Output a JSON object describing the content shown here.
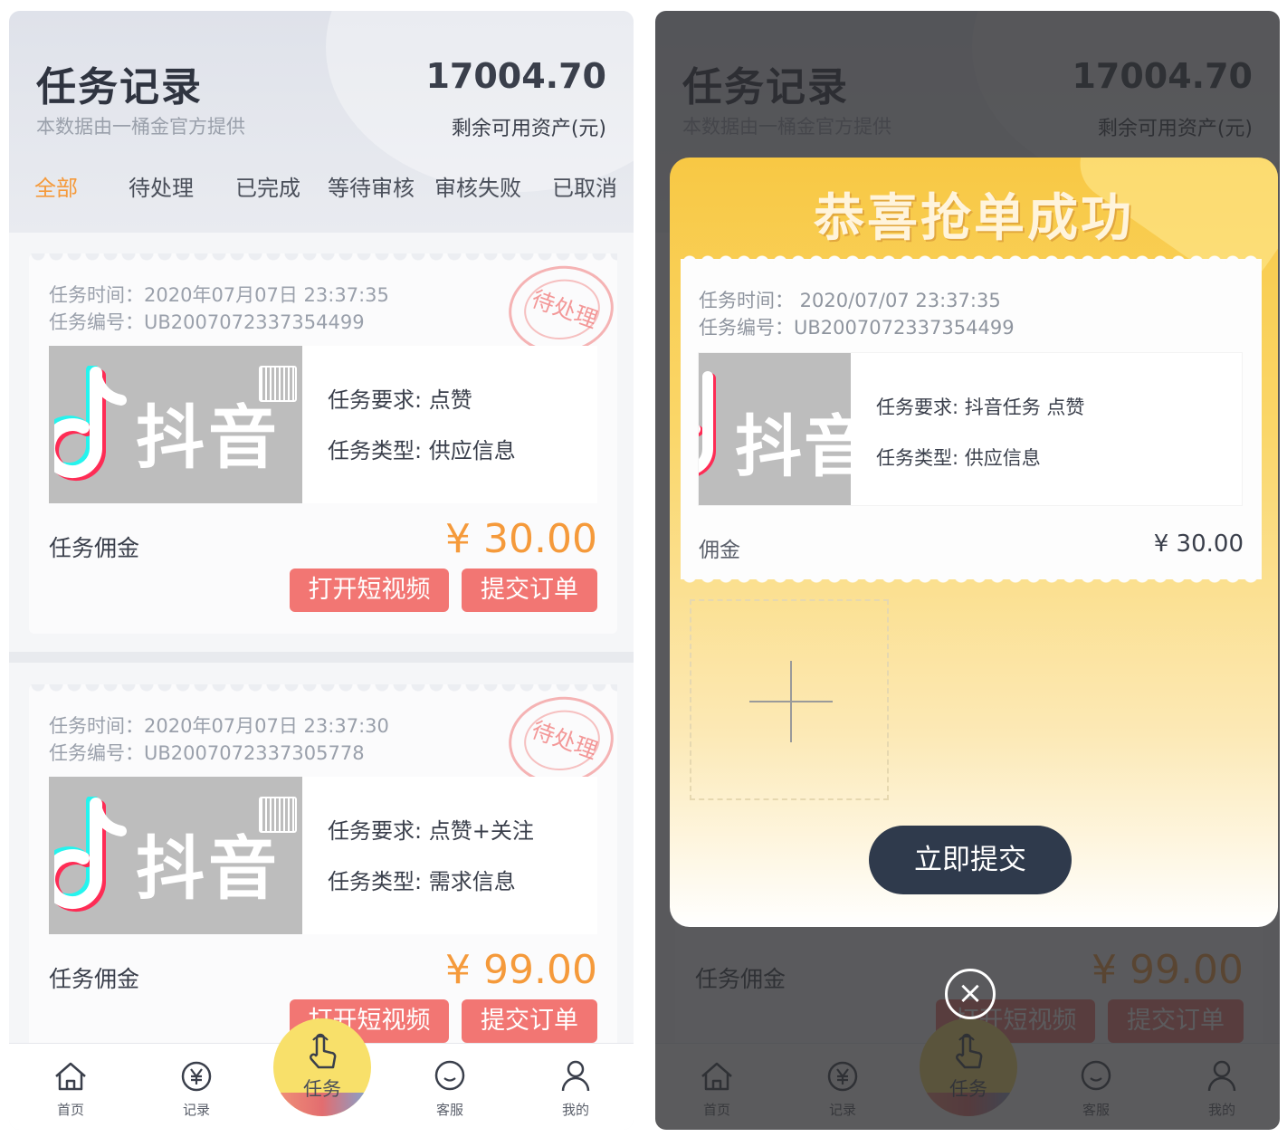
{
  "header": {
    "title": "任务记录",
    "subtitle": "本数据由一桶金官方提供",
    "amount": "17004.70",
    "amount_label": "剩余可用资产(元)"
  },
  "tabs": [
    {
      "label": "全部",
      "active": true
    },
    {
      "label": "待处理",
      "active": false
    },
    {
      "label": "已完成",
      "active": false
    },
    {
      "label": "等待审核",
      "active": false
    },
    {
      "label": "审核失败",
      "active": false
    },
    {
      "label": "已取消",
      "active": false
    }
  ],
  "tasks": [
    {
      "time": "任务时间：2020年07月07日 23:37:35",
      "number": "任务编号：UB2007072337354499",
      "status": "待处理",
      "thumbnail_text": "抖音",
      "requirement": "任务要求: 点赞",
      "type": "任务类型: 供应信息",
      "fee_label": "任务佣金",
      "fee": "¥ 30.00",
      "open_button": "打开短视频",
      "submit_button": "提交订单"
    },
    {
      "time": "任务时间：2020年07月07日 23:37:30",
      "number": "任务编号：UB2007072337305778",
      "status": "待处理",
      "thumbnail_text": "抖音",
      "requirement": "任务要求: 点赞+关注",
      "type": "任务类型: 需求信息",
      "fee_label": "任务佣金",
      "fee": "¥ 99.00",
      "open_button": "打开短视频",
      "submit_button": "提交订单"
    }
  ],
  "nav": {
    "home": "首页",
    "records": "记录",
    "task": "任务",
    "service": "客服",
    "mine": "我的"
  },
  "modal": {
    "title": "恭喜抢单成功",
    "time": "任务时间： 2020/07/07 23:37:35",
    "number": "任务编号：UB2007072337354499",
    "thumbnail_text": "抖音",
    "requirement": "任务要求: 抖音任务  点赞",
    "type": "任务类型: 供应信息",
    "fee_label": "佣金",
    "fee": "¥ 30.00",
    "submit_button": "立即提交",
    "close_icon": "×"
  },
  "colors": {
    "accent_orange": "#f59a3b",
    "button_red": "#f27673",
    "submit_dark": "#2f3a4c",
    "modal_yellow": "#f8c844"
  },
  "icons": [
    "home-icon",
    "yuan-record-icon",
    "hand-tap-icon",
    "chat-bubble-icon",
    "user-icon",
    "close-icon",
    "plus-icon",
    "tiktok-note-icon",
    "gift-box-icon"
  ]
}
